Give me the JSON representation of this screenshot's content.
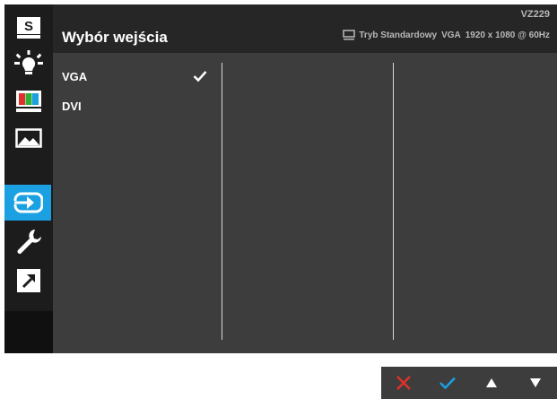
{
  "header": {
    "title": "Wybór wejścia",
    "model": "VZ229",
    "status": {
      "mode": "Tryb Standardowy",
      "input": "VGA",
      "resolution": "1920 x 1080 @ 60Hz"
    }
  },
  "sidebar": {
    "items": [
      {
        "icon": "splendid-s-icon"
      },
      {
        "icon": "bluelight-filter-icon"
      },
      {
        "icon": "color-icon"
      },
      {
        "icon": "image-icon"
      },
      {
        "icon": "input-select-icon",
        "active": true
      },
      {
        "icon": "system-setup-icon"
      },
      {
        "icon": "shortcut-icon"
      }
    ]
  },
  "options": [
    {
      "label": "VGA",
      "selected": true
    },
    {
      "label": "DVI",
      "selected": false
    }
  ],
  "nav": {
    "buttons": [
      "close-icon",
      "confirm-icon",
      "up-arrow-icon",
      "down-arrow-icon"
    ]
  },
  "colors": {
    "accent": "#1ba0e2",
    "close": "#e0302a",
    "confirm": "#1ba0e2"
  }
}
